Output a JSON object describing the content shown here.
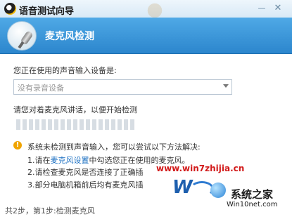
{
  "window": {
    "title": "语音测试向导",
    "minimize_glyph": "—",
    "close_glyph": "✕"
  },
  "header": {
    "title": "麦克风检测",
    "icon": "microphone-icon"
  },
  "device": {
    "label": "您正在使用的声音输入设备是:",
    "selected": "没有录音设备"
  },
  "speak": {
    "label": "请您对着麦克风讲话，以便开始检测",
    "level": 0
  },
  "warning": {
    "text": "系统未检测到声音输入，您可以尝试以下方法解决:",
    "tips": [
      {
        "prefix": "1.请在",
        "link": "麦克风设置",
        "suffix": "中勾选您正在使用的麦克风。"
      },
      {
        "text": "2.请检查麦克风是否连接了正确插"
      },
      {
        "text": "3.部分电脑机箱前后均有麦克风插"
      }
    ]
  },
  "watermark": {
    "site": "www.win7zhijia.cn",
    "brand_cn": "系统之家",
    "brand_url": "Win10net.com"
  },
  "footer": {
    "step": "共2步，第1步:检测麦克风"
  },
  "colors": {
    "header_bg": "#3a96d9",
    "link": "#1a6fc2",
    "warning": "#f0a400",
    "watermark_red": "#d21a1a"
  }
}
